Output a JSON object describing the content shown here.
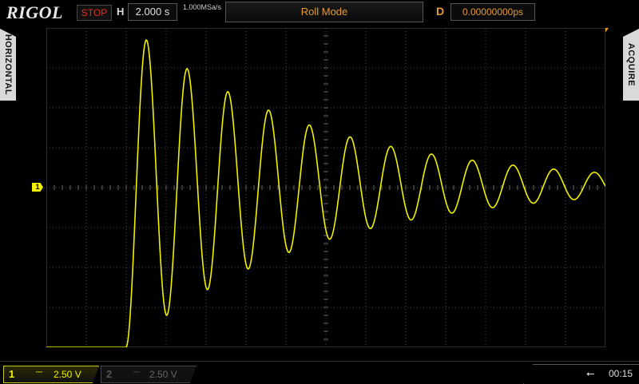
{
  "header": {
    "brand": "RIGOL",
    "run_state": "STOP",
    "timebase_label": "H",
    "timebase_value": "2.000 s",
    "sample_rate": "1.000MSa/s",
    "mode": "Roll Mode",
    "delay_label": "D",
    "delay_value": "0.00000000ps"
  },
  "side_tabs": {
    "left": "HORIZONTAL",
    "right": "ACQUIRE"
  },
  "channels": [
    {
      "number": "1",
      "coupling_symbol": "⎓",
      "scale": "2.50 V",
      "active": true
    },
    {
      "number": "2",
      "coupling_symbol": "⎓",
      "scale": "2.50 V",
      "active": false
    }
  ],
  "channel1_marker": "1",
  "status": {
    "usb_symbol": "⭠",
    "time": "00:15"
  },
  "colors": {
    "trace": "#f0f000",
    "accent": "#e69a2e",
    "stop": "#e03020"
  }
}
